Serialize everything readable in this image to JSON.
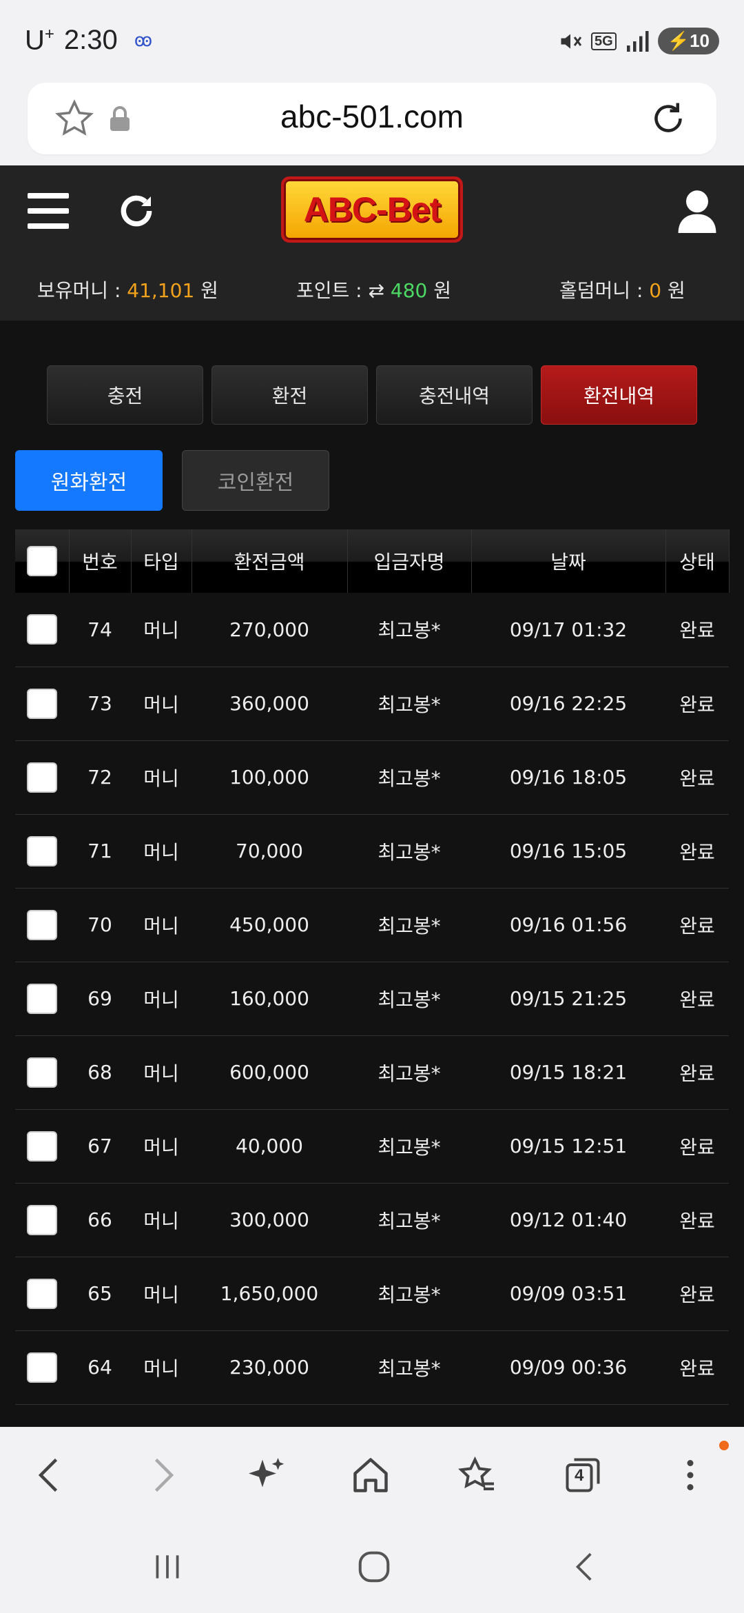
{
  "status_bar": {
    "carrier": "U",
    "carrier_sup": "+",
    "time": "2:30",
    "network": "5G",
    "battery": "10"
  },
  "browser": {
    "url": "abc-501.com"
  },
  "site": {
    "logo": "ABC-Bet",
    "balances": {
      "money_label": "보유머니 : ",
      "money_value": "41,101",
      "money_unit": " 원",
      "point_label": "포인트 : ",
      "point_value": "480",
      "point_unit": " 원",
      "hold_label": "홀덤머니 : ",
      "hold_value": "0",
      "hold_unit": " 원"
    }
  },
  "tabs": [
    "충전",
    "환전",
    "충전내역",
    "환전내역"
  ],
  "active_tab": "환전내역",
  "subtabs": [
    "원화환전",
    "코인환전"
  ],
  "table": {
    "headers": [
      "번호",
      "타입",
      "환전금액",
      "입금자명",
      "날짜",
      "상태"
    ],
    "rows": [
      {
        "no": "74",
        "type": "머니",
        "amount": "270,000",
        "name": "최고봉*",
        "date": "09/17 01:32",
        "status": "완료"
      },
      {
        "no": "73",
        "type": "머니",
        "amount": "360,000",
        "name": "최고봉*",
        "date": "09/16 22:25",
        "status": "완료"
      },
      {
        "no": "72",
        "type": "머니",
        "amount": "100,000",
        "name": "최고봉*",
        "date": "09/16 18:05",
        "status": "완료"
      },
      {
        "no": "71",
        "type": "머니",
        "amount": "70,000",
        "name": "최고봉*",
        "date": "09/16 15:05",
        "status": "완료"
      },
      {
        "no": "70",
        "type": "머니",
        "amount": "450,000",
        "name": "최고봉*",
        "date": "09/16 01:56",
        "status": "완료"
      },
      {
        "no": "69",
        "type": "머니",
        "amount": "160,000",
        "name": "최고봉*",
        "date": "09/15 21:25",
        "status": "완료"
      },
      {
        "no": "68",
        "type": "머니",
        "amount": "600,000",
        "name": "최고봉*",
        "date": "09/15 18:21",
        "status": "완료"
      },
      {
        "no": "67",
        "type": "머니",
        "amount": "40,000",
        "name": "최고봉*",
        "date": "09/15 12:51",
        "status": "완료"
      },
      {
        "no": "66",
        "type": "머니",
        "amount": "300,000",
        "name": "최고봉*",
        "date": "09/12 01:40",
        "status": "완료"
      },
      {
        "no": "65",
        "type": "머니",
        "amount": "1,650,000",
        "name": "최고봉*",
        "date": "09/09 03:51",
        "status": "완료"
      },
      {
        "no": "64",
        "type": "머니",
        "amount": "230,000",
        "name": "최고봉*",
        "date": "09/09 00:36",
        "status": "완료"
      }
    ]
  },
  "browser_nav": {
    "tab_count": "4"
  },
  "colors": {
    "accent_blue": "#1479ff",
    "active_red": "#b51a1a",
    "money_orange": "#f3a21b",
    "point_green": "#4cd964"
  }
}
